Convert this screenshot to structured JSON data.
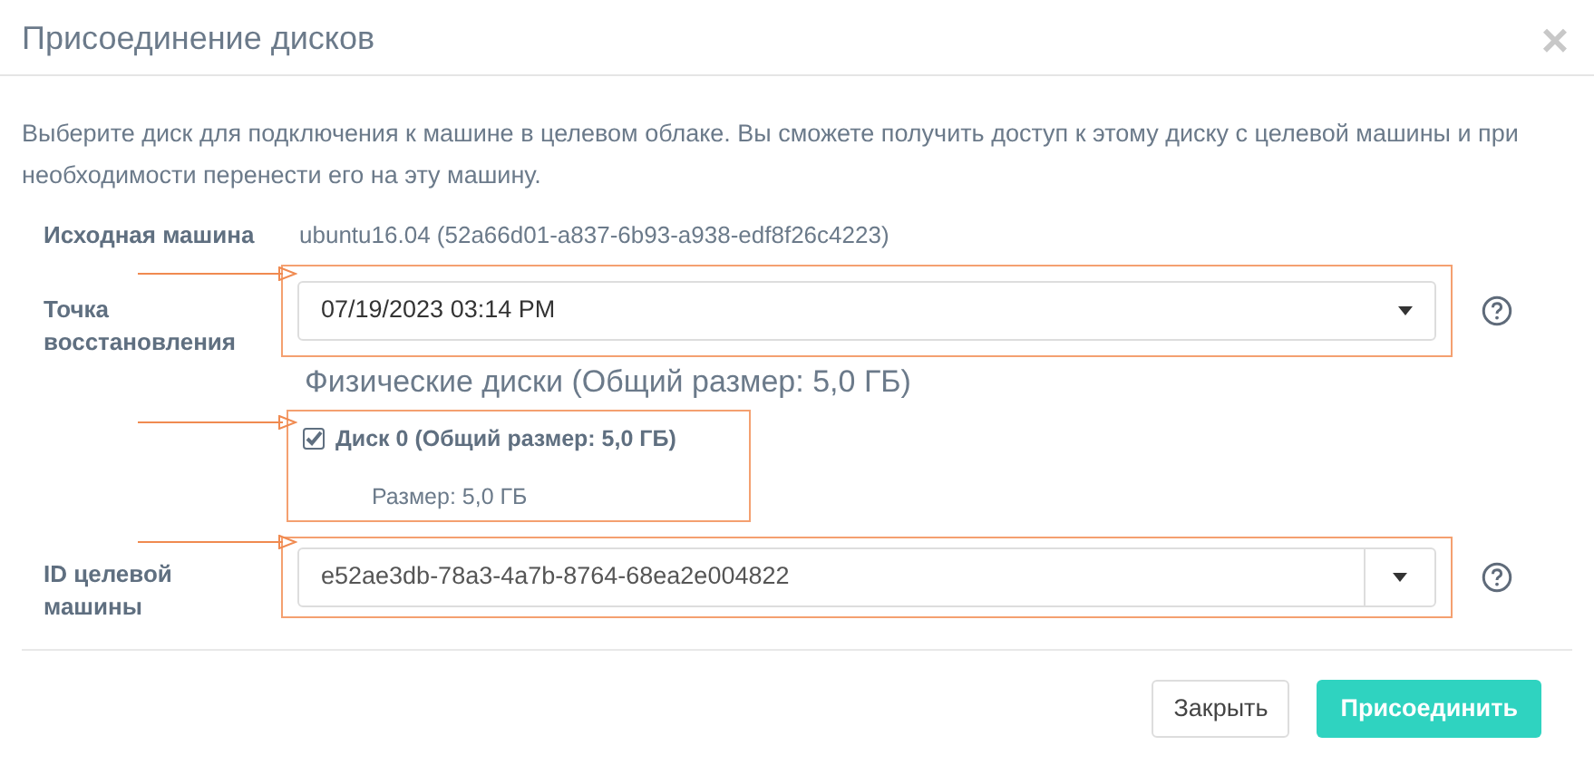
{
  "dialog": {
    "title": "Присоединение дисков",
    "close": "×"
  },
  "description": "Выберите диск для подключения к машине в целевом облаке. Вы сможете получить доступ к этому диску с целевой машины и при необходимости перенести его на эту машину.",
  "source_machine": {
    "label": "Исходная машина",
    "value": "ubuntu16.04 (52a66d01-a837-6b93-a938-edf8f26c4223)"
  },
  "restore_point": {
    "label": "Точка восстановления",
    "value": "07/19/2023 03:14 PM"
  },
  "disks": {
    "heading": "Физические диски (Общий размер: 5,0 ГБ)",
    "items": [
      {
        "label": "Диск 0 (Общий размер: 5,0 ГБ)",
        "checked": true,
        "size": "Размер: 5,0 ГБ"
      }
    ]
  },
  "target_machine": {
    "label": "ID целевой машины",
    "value": "e52ae3db-78a3-4a7b-8764-68ea2e004822"
  },
  "buttons": [
    {
      "label": "Закрыть",
      "kind": "default"
    },
    {
      "label": "Присоединить",
      "kind": "primary"
    }
  ]
}
